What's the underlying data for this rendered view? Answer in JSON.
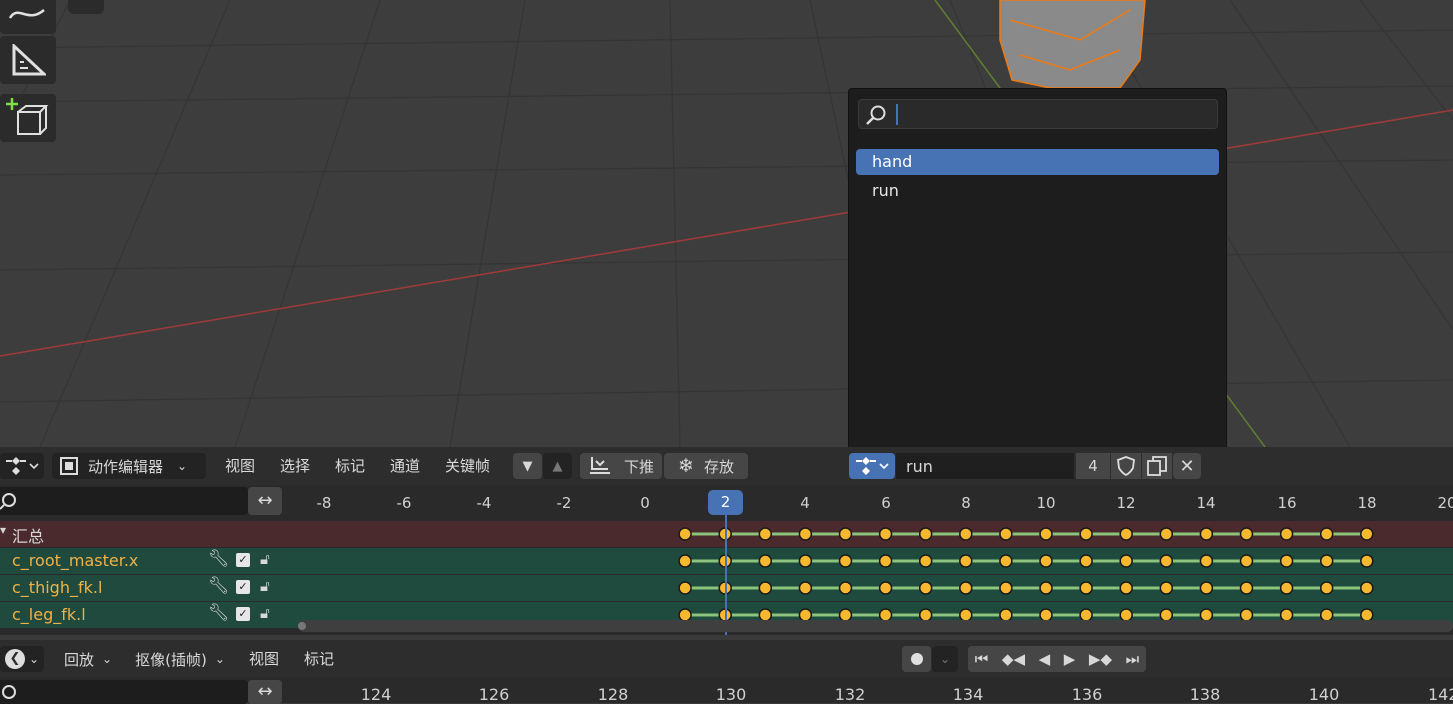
{
  "dopesheet_header": {
    "editor_type": "动作编辑器",
    "menus": [
      "视图",
      "选择",
      "标记",
      "通道",
      "关键帧"
    ],
    "push_down_label": "下推",
    "stash_label": "存放",
    "action_name": "run",
    "user_count": "4"
  },
  "action_popup": {
    "search_value": "",
    "search_placeholder": "",
    "items": [
      "hand",
      "run"
    ],
    "selected": "hand"
  },
  "dopesheet": {
    "current_frame": "2",
    "ruler_ticks": [
      "-8",
      "-6",
      "-4",
      "-2",
      "0",
      "2",
      "4",
      "6",
      "8",
      "10",
      "12",
      "14",
      "16",
      "18",
      "20"
    ],
    "summary_label": "汇总",
    "channels": [
      "c_root_master.x",
      "c_thigh_fk.l",
      "c_leg_fk.l"
    ]
  },
  "timeline_header": {
    "playback_label": "回放",
    "keying_label": "抠像(插帧)",
    "menus": [
      "视图",
      "标记"
    ]
  },
  "timeline": {
    "ruler_ticks": [
      "124",
      "126",
      "128",
      "130",
      "132",
      "134",
      "136",
      "138",
      "140",
      "142"
    ]
  },
  "colors": {
    "accent": "#4772b3",
    "keyframe": "#f6b82f",
    "channel_text": "#f3b144",
    "summary_row": "#5a2a2e",
    "channel_row": "#1f4a3d",
    "selection_wire": "#f07a12"
  },
  "icons": [
    "draw-icon",
    "measure-icon",
    "add-cube-icon",
    "search-icon",
    "swap-arrows-icon",
    "wrench-icon",
    "checkbox-icon",
    "lock-icon",
    "shield-icon",
    "copy-icon",
    "close-icon",
    "record-icon",
    "jump-start-icon",
    "prev-key-icon",
    "play-reverse-icon",
    "play-icon",
    "next-key-icon",
    "jump-end-icon"
  ]
}
